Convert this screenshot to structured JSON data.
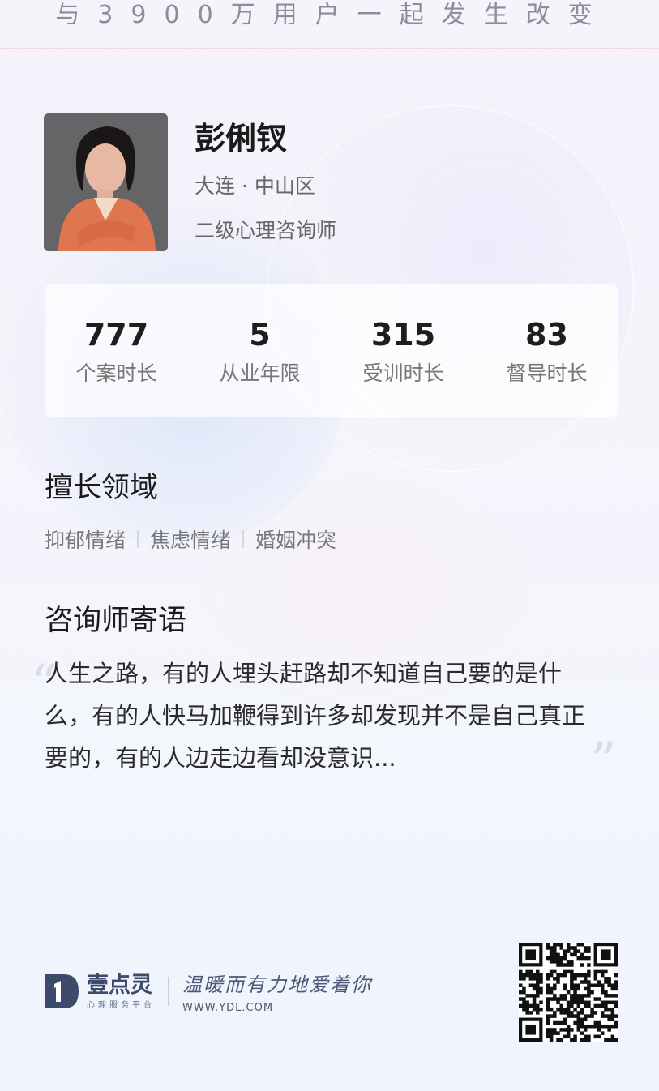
{
  "slogan": "与3900万用户一起发生改变",
  "profile": {
    "name": "彭俐钗",
    "location": "大连 · 中山区",
    "title": "二级心理咨询师"
  },
  "stats": [
    {
      "value": "777",
      "label": "个案时长"
    },
    {
      "value": "5",
      "label": "从业年限"
    },
    {
      "value": "315",
      "label": "受训时长"
    },
    {
      "value": "83",
      "label": "督导时长"
    }
  ],
  "specialties": {
    "heading": "擅长领域",
    "tags": [
      "抑郁情绪",
      "焦虑情绪",
      "婚姻冲突"
    ]
  },
  "message": {
    "heading": "咨询师寄语",
    "text": "人生之路，有的人埋头赶路却不知道自己要的是什么，有的人快马加鞭得到许多却发现并不是自己真正要的，有的人边走边看却没意识..."
  },
  "footer": {
    "brand": "壹点灵",
    "brand_sub": "心理服务平台",
    "tagline": "温暖而有力地爱着你",
    "website": "WWW.YDL.COM"
  },
  "colors": {
    "accent": "#3e4a6c"
  }
}
